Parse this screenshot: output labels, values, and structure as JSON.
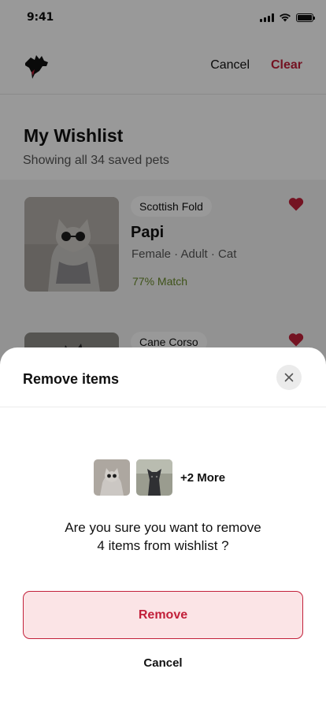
{
  "status_bar": {
    "time": "9:41",
    "icons": [
      "signal-icon",
      "wifi-icon",
      "battery-icon"
    ]
  },
  "header": {
    "logo_icon": "dog-logo-icon",
    "cancel_label": "Cancel",
    "clear_label": "Clear"
  },
  "wishlist": {
    "title": "My Wishlist",
    "subtitle": "Showing all 34 saved pets",
    "pets": [
      {
        "breed": "Scottish Fold",
        "name": "Papi",
        "meta": "Female · Adult · Cat",
        "match": "77% Match",
        "favorited": true
      },
      {
        "breed": "Cane Corso",
        "favorited": true
      }
    ]
  },
  "sheet": {
    "title": "Remove items",
    "close_icon": "close-icon",
    "more_label": "+2 More",
    "message_line1": "Are you sure you want to remove",
    "message_line2": "4 items from wishlist ?",
    "remove_label": "Remove",
    "cancel_label": "Cancel"
  },
  "colors": {
    "accent": "#c2203a",
    "accent_soft": "#fbe4e6",
    "match": "#6a8a2a",
    "overlay": "rgba(0,0,0,0.40)"
  }
}
